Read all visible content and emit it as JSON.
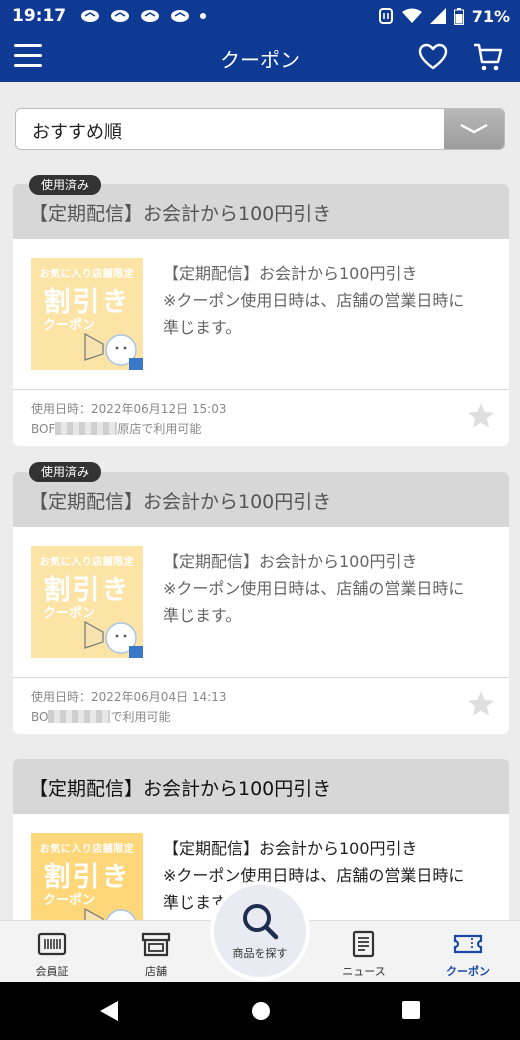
{
  "status_bar": {
    "time": "19:17",
    "battery": "71%"
  },
  "app_bar": {
    "title": "クーポン",
    "icons": [
      "menu-icon",
      "heart-icon",
      "cart-icon"
    ]
  },
  "sort": {
    "selected": "おすすめ順"
  },
  "coupons": [
    {
      "badge": "使用済み",
      "title": "【定期配信】お会計から100円引き",
      "thumb_line1": "お気に入り店舗限定",
      "thumb_line2": "割引き",
      "thumb_line3": "クーポン",
      "desc_line1": "【定期配信】お会計から100円引き",
      "desc_line2": "※クーポン使用日時は、店舗の営業日時に",
      "desc_line3": "準じます。",
      "used_at": "使用日時：2022年06月12日 15:03",
      "store_prefix": "BOF",
      "store_suffix": "原店で利用可能"
    },
    {
      "badge": "使用済み",
      "title": "【定期配信】お会計から100円引き",
      "thumb_line1": "お気に入り店舗限定",
      "thumb_line2": "割引き",
      "thumb_line3": "クーポン",
      "desc_line1": "【定期配信】お会計から100円引き",
      "desc_line2": "※クーポン使用日時は、店舗の営業日時に",
      "desc_line3": "準じます。",
      "used_at": "使用日時：2022年06月04日 14:13",
      "store_prefix": "BO",
      "store_suffix": "で利用可能"
    },
    {
      "title": "【定期配信】お会計から100円引き",
      "thumb_line1": "お気に入り店舗限定",
      "thumb_line2": "割引き",
      "thumb_line3": "クーポン",
      "desc_line1": "【定期配信】お会計から100円引き",
      "desc_line2": "※クーポン使用日時は、店舗の営業日時に",
      "desc_line3": "準じます"
    }
  ],
  "bottom_nav": {
    "member": "会員証",
    "stores": "店舗",
    "search": "商品を探す",
    "news": "ニュース",
    "coupon": "クーポン"
  },
  "colors": {
    "brand": "#0f3a93",
    "selected_tab": "#1a4aa8"
  }
}
